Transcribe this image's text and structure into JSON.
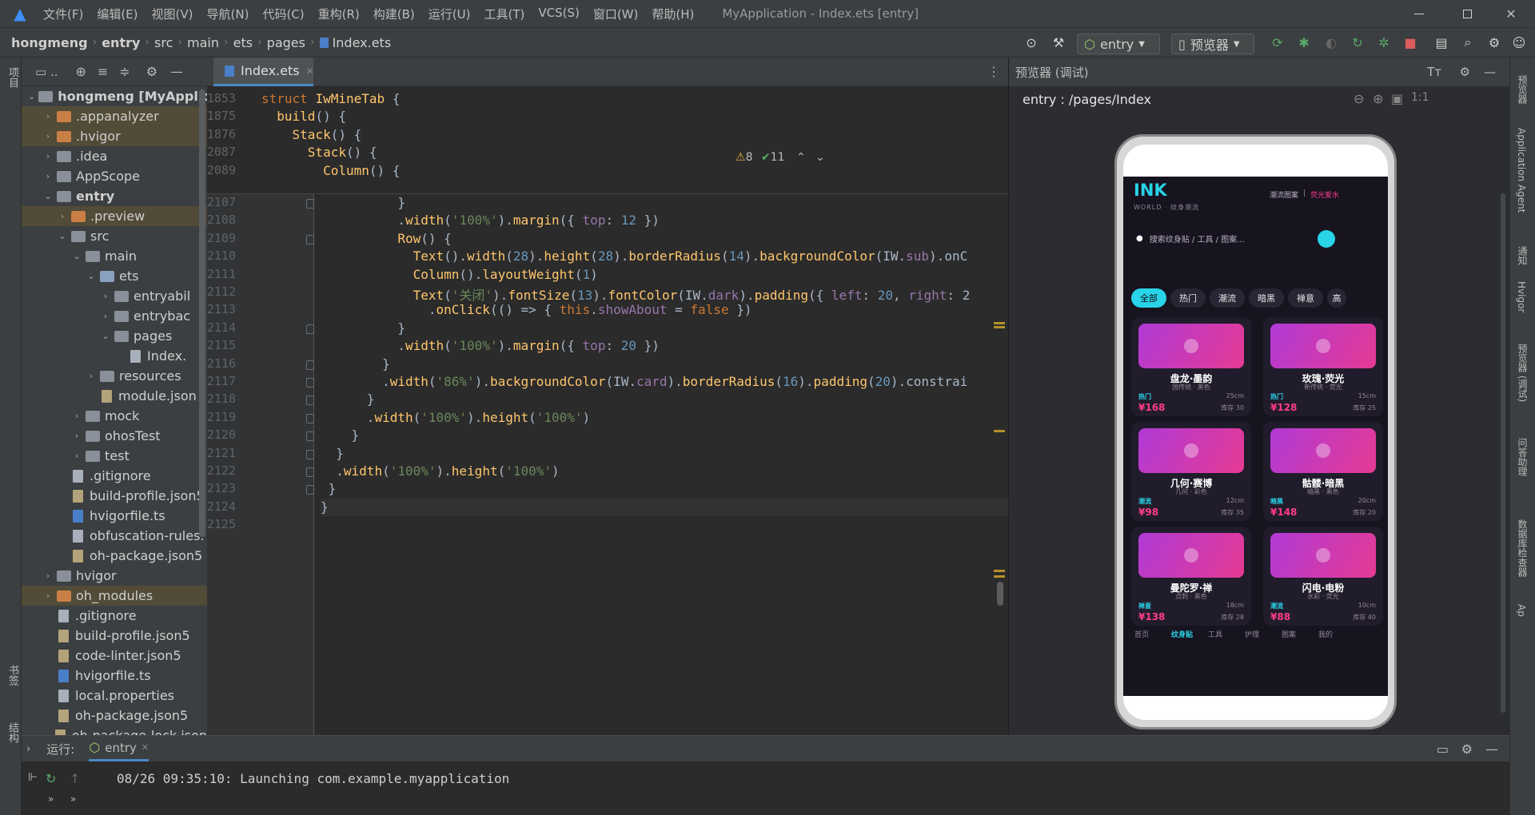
{
  "menubar": {
    "items": [
      "文件(F)",
      "编辑(E)",
      "视图(V)",
      "导航(N)",
      "代码(C)",
      "重构(R)",
      "构建(B)",
      "运行(U)",
      "工具(T)",
      "VCS(S)",
      "窗口(W)",
      "帮助(H)"
    ],
    "title": "MyApplication - Index.ets [entry]"
  },
  "breadcrumb": [
    "hongmeng",
    "entry",
    "src",
    "main",
    "ets",
    "pages",
    "Index.ets"
  ],
  "toolbar": {
    "config": "entry",
    "previewer": "预览器"
  },
  "leftstrip": {
    "project": "项目",
    "bookmarks": "书签",
    "structure": "结构"
  },
  "tree": {
    "rows": [
      {
        "label": "hongmeng [MyApplicati",
        "indent": 0,
        "arrow": "⌄",
        "icon": "folder"
      },
      {
        "label": ".appanalyzer",
        "indent": 1,
        "arrow": "›",
        "icon": "folder-orange"
      },
      {
        "label": ".hvigor",
        "indent": 1,
        "arrow": "›",
        "icon": "folder-orange"
      },
      {
        "label": ".idea",
        "indent": 1,
        "arrow": "›",
        "icon": "folder"
      },
      {
        "label": "AppScope",
        "indent": 1,
        "arrow": "›",
        "icon": "folder"
      },
      {
        "label": "entry",
        "indent": 1,
        "arrow": "⌄",
        "icon": "folder"
      },
      {
        "label": ".preview",
        "indent": 2,
        "arrow": "›",
        "icon": "folder-orange"
      },
      {
        "label": "src",
        "indent": 2,
        "arrow": "⌄",
        "icon": "folder"
      },
      {
        "label": "main",
        "indent": 3,
        "arrow": "⌄",
        "icon": "folder"
      },
      {
        "label": "ets",
        "indent": 4,
        "arrow": "⌄",
        "icon": "folder-blue"
      },
      {
        "label": "entryabil",
        "indent": 5,
        "arrow": "›",
        "icon": "folder"
      },
      {
        "label": "entrybac",
        "indent": 5,
        "arrow": "›",
        "icon": "folder"
      },
      {
        "label": "pages",
        "indent": 5,
        "arrow": "⌄",
        "icon": "folder"
      },
      {
        "label": "Index.",
        "indent": 6,
        "arrow": "",
        "icon": "file"
      },
      {
        "label": "resources",
        "indent": 4,
        "arrow": "›",
        "icon": "folder"
      },
      {
        "label": "module.json",
        "indent": 4,
        "arrow": "",
        "icon": "file-json"
      },
      {
        "label": "mock",
        "indent": 3,
        "arrow": "›",
        "icon": "folder"
      },
      {
        "label": "ohosTest",
        "indent": 3,
        "arrow": "›",
        "icon": "folder"
      },
      {
        "label": "test",
        "indent": 3,
        "arrow": "›",
        "icon": "folder"
      },
      {
        "label": ".gitignore",
        "indent": 2,
        "arrow": "",
        "icon": "file"
      },
      {
        "label": "build-profile.json5",
        "indent": 2,
        "arrow": "",
        "icon": "file-json"
      },
      {
        "label": "hvigorfile.ts",
        "indent": 2,
        "arrow": "",
        "icon": "file-ts"
      },
      {
        "label": "obfuscation-rules.",
        "indent": 2,
        "arrow": "",
        "icon": "file"
      },
      {
        "label": "oh-package.json5",
        "indent": 2,
        "arrow": "",
        "icon": "file-json"
      },
      {
        "label": "hvigor",
        "indent": 1,
        "arrow": "›",
        "icon": "folder"
      },
      {
        "label": "oh_modules",
        "indent": 1,
        "arrow": "›",
        "icon": "folder-orange"
      },
      {
        "label": ".gitignore",
        "indent": 1,
        "arrow": "",
        "icon": "file"
      },
      {
        "label": "build-profile.json5",
        "indent": 1,
        "arrow": "",
        "icon": "file-json"
      },
      {
        "label": "code-linter.json5",
        "indent": 1,
        "arrow": "",
        "icon": "file-json"
      },
      {
        "label": "hvigorfile.ts",
        "indent": 1,
        "arrow": "",
        "icon": "file-ts"
      },
      {
        "label": "local.properties",
        "indent": 1,
        "arrow": "",
        "icon": "file"
      },
      {
        "label": "oh-package.json5",
        "indent": 1,
        "arrow": "",
        "icon": "file-json"
      },
      {
        "label": "oh-package-lock.json",
        "indent": 1,
        "arrow": "",
        "icon": "file-json"
      }
    ]
  },
  "editor": {
    "tab": "Index.ets",
    "warnings": "8",
    "weak_warnings": "11",
    "sticky": [
      {
        "num": "1853",
        "html": "<span class='kw'>struct</span> <span class='fn'>IwMineTab</span> {"
      },
      {
        "num": "1875",
        "html": "  <span class='fn'>build</span>() {"
      },
      {
        "num": "1876",
        "html": "    <span class='fn'>Stack</span>() {"
      },
      {
        "num": "2087",
        "html": "      <span class='fn'>Stack</span>() {"
      },
      {
        "num": "2089",
        "html": "        <span class='fn'>Column</span>() {"
      }
    ],
    "lines": [
      {
        "num": "2107",
        "html": "          }"
      },
      {
        "num": "2108",
        "html": "          .<span class='fn'>width</span>(<span class='st'>'100%'</span>).<span class='fn'>margin</span>({ <span class='pr'>top</span>: <span class='nm'>12</span> })"
      },
      {
        "num": "2109",
        "html": "          <span class='fn'>Row</span>() {"
      },
      {
        "num": "2110",
        "html": "            <span class='fn'>Text</span>().<span class='fn'>width</span>(<span class='nm'>28</span>).<span class='fn'>height</span>(<span class='nm'>28</span>).<span class='fn'>borderRadius</span>(<span class='nm'>14</span>).<span class='fn'>backgroundColor</span>(IW.<span class='pr'>sub</span>).onC"
      },
      {
        "num": "2111",
        "html": "            <span class='fn'>Column</span>().<span class='fn'>layoutWeight</span>(<span class='nm'>1</span>)"
      },
      {
        "num": "2112",
        "html": "            <span class='fn'>Text</span>(<span class='st'>'关闭'</span>).<span class='fn'>fontSize</span>(<span class='nm'>13</span>).<span class='fn'>fontColor</span>(IW.<span class='pr'>dark</span>).<span class='fn'>padding</span>({ <span class='pr'>left</span>: <span class='nm'>20</span>, <span class='pr'>right</span>: 2"
      },
      {
        "num": "2113",
        "html": "              .<span class='fn'>onClick</span>(() => { <span class='kw'>this</span>.<span class='pr'>showAbout</span> = <span class='kw'>false</span> })"
      },
      {
        "num": "2114",
        "html": "          }"
      },
      {
        "num": "2115",
        "html": "          .<span class='fn'>width</span>(<span class='st'>'100%'</span>).<span class='fn'>margin</span>({ <span class='pr'>top</span>: <span class='nm'>20</span> })"
      },
      {
        "num": "2116",
        "html": "        }"
      },
      {
        "num": "2117",
        "html": "        .<span class='fn'>width</span>(<span class='st'>'86%'</span>).<span class='fn'>backgroundColor</span>(IW.<span class='pr'>card</span>).<span class='fn'>borderRadius</span>(<span class='nm'>16</span>).<span class='fn'>padding</span>(<span class='nm'>20</span>).constrai"
      },
      {
        "num": "2118",
        "html": "      }"
      },
      {
        "num": "2119",
        "html": "      .<span class='fn'>width</span>(<span class='st'>'100%'</span>).<span class='fn'>height</span>(<span class='st'>'100%'</span>)"
      },
      {
        "num": "2120",
        "html": "    }"
      },
      {
        "num": "2121",
        "html": "  }"
      },
      {
        "num": "2122",
        "html": "  .<span class='fn'>width</span>(<span class='st'>'100%'</span>).<span class='fn'>height</span>(<span class='st'>'100%'</span>)"
      },
      {
        "num": "2123",
        "html": " }"
      },
      {
        "num": "2124",
        "html": "}"
      },
      {
        "num": "2125",
        "html": ""
      }
    ]
  },
  "preview": {
    "header": "预览器 (调试)",
    "route": "entry : /pages/Index",
    "app": {
      "logo": "INK",
      "logo_sub": "WORLD · 纹身潮流",
      "header_link1": "潮流图案",
      "header_link2": "荧光爱水",
      "search_placeholder": "搜索纹身贴 / 工具 / 图案...",
      "chips": [
        "全部",
        "热门",
        "潮流",
        "暗黑",
        "禅意",
        "高"
      ],
      "cards": [
        {
          "name": "盘龙·墨韵",
          "sub": "国传统 · 黑色",
          "tag": "热门",
          "tag_color": "#29d3e8",
          "size": "25cm",
          "price": "¥168",
          "stock": "库存 30"
        },
        {
          "name": "玫瑰·荧光",
          "sub": "新传统 · 荧光",
          "tag": "热门",
          "tag_color": "#29d3e8",
          "size": "15cm",
          "price": "¥128",
          "stock": "库存 25"
        },
        {
          "name": "几何·赛博",
          "sub": "几何 · 彩色",
          "tag": "潮流",
          "tag_color": "#29d3e8",
          "size": "12cm",
          "price": "¥98",
          "stock": "库存 35"
        },
        {
          "name": "骷髅·暗黑",
          "sub": "暗黑 · 黑色",
          "tag": "暗黑",
          "tag_color": "#29d3e8",
          "size": "20cm",
          "price": "¥148",
          "stock": "库存 20"
        },
        {
          "name": "曼陀罗·禅",
          "sub": "点刺 · 黑色",
          "tag": "禅意",
          "tag_color": "#29d3e8",
          "size": "18cm",
          "price": "¥138",
          "stock": "库存 28"
        },
        {
          "name": "闪电·电粉",
          "sub": "水彩 · 荧光",
          "tag": "潮流",
          "tag_color": "#29d3e8",
          "size": "10cm",
          "price": "¥88",
          "stock": "库存 40"
        }
      ],
      "bottom_nav": [
        "首页",
        "纹身贴",
        "工具",
        "护理",
        "图案",
        "我的"
      ],
      "accent": "#29d3e8",
      "price_color": "#ff3c8a"
    }
  },
  "rightstrip": [
    "预览器",
    "Application Agent",
    "通知",
    "Hvigor",
    "预览器 (调试)",
    "问答助理",
    "数据库检查器",
    "Ap"
  ],
  "run": {
    "label": "运行:",
    "config": "entry",
    "console": "08/26 09:35:10: Launching com.example.myapplication"
  }
}
